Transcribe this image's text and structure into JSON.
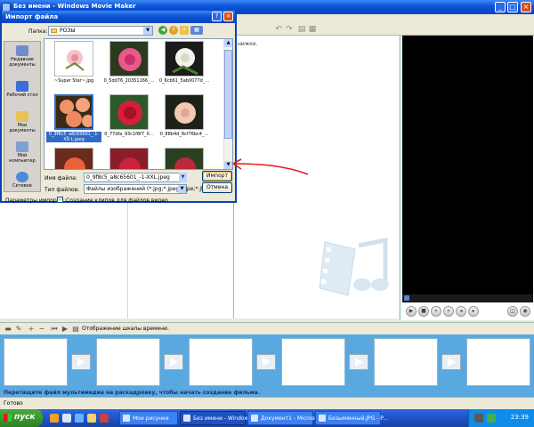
{
  "window": {
    "title": "Без имени - Windows Movie Maker"
  },
  "collection": {
    "hint": "нижке."
  },
  "storyboard": {
    "show_timeline_label": "Отображение шкалы времени.",
    "hint": "Перетащите файл мультимедиа на раскадровку, чтобы начать создание фильма."
  },
  "status": {
    "text": "Готово"
  },
  "dialog": {
    "title": "Импорт файла",
    "look_in_label": "Папка:",
    "look_in_value": "РОЗЫ",
    "places": [
      {
        "label": "Недавние документы",
        "icon": "recent-documents-icon"
      },
      {
        "label": "Рабочий стол",
        "icon": "desktop-icon"
      },
      {
        "label": "Мои документы",
        "icon": "my-documents-icon"
      },
      {
        "label": "Мой компьютер",
        "icon": "my-computer-icon"
      },
      {
        "label": "Сетевое",
        "icon": "network-icon"
      }
    ],
    "files": [
      {
        "name": "~Super Star~.jpg"
      },
      {
        "name": "0_5dd76_20351166_..."
      },
      {
        "name": "0_6cb61_5ab0077d_..."
      },
      {
        "name": "0_9f8c5_a8c65601_-1-XX-L.jpeg"
      },
      {
        "name": "0_77dfa_93c1f8f7_X..."
      },
      {
        "name": "0_88b4d_8cf76bc4_..."
      },
      {
        "name": ""
      },
      {
        "name": ""
      },
      {
        "name": ""
      }
    ],
    "file_name_label": "Имя файла:",
    "file_name_value": "0_9f8c5_a8c65601_-1-XXL.jpeg",
    "file_type_label": "Тип файлов:",
    "file_type_value": "Файлы изображений (*.jpg;*.jpeg;*.jpe;*.jfif;*...",
    "import_button": "Импорт",
    "cancel_button": "Отмена",
    "params_label": "Параметры импорта:",
    "create_clips_label": "Создание клипов для файлов видео",
    "create_clips_checked": true
  },
  "taskbar": {
    "start_label": "пуск",
    "tasks": [
      {
        "label": "Мои рисунки"
      },
      {
        "label": "Без имени - Windows..."
      },
      {
        "label": "Документ1 - Microso..."
      },
      {
        "label": "Безымянный.JPG - P..."
      }
    ],
    "clock": "23:39"
  },
  "colors": {
    "title_bar": "#0a52d4",
    "storyboard_bg": "#5aa8e0",
    "selection": "#316ac5",
    "annotation_arrow": "#e01b1b"
  }
}
